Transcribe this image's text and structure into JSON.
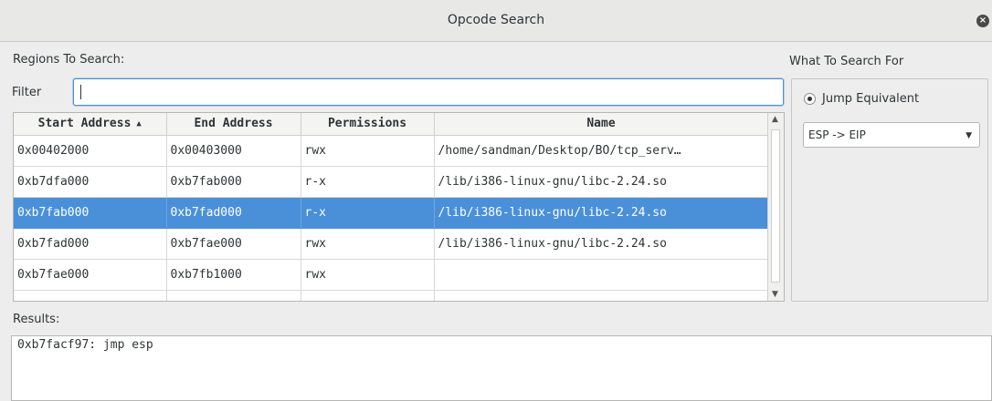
{
  "window": {
    "title": "Opcode Search",
    "close_glyph": "×"
  },
  "regions_label": "Regions To Search:",
  "filter": {
    "label": "Filter",
    "value": "",
    "placeholder": ""
  },
  "table": {
    "columns": [
      "Start Address",
      "End Address",
      "Permissions",
      "Name"
    ],
    "sort_indicator": "▲",
    "rows": [
      {
        "start": "0x00402000",
        "end": "0x00403000",
        "perm": "rwx",
        "name": "/home/sandman/Desktop/BO/tcp_serv…"
      },
      {
        "start": "0xb7dfa000",
        "end": "0xb7fab000",
        "perm": "r-x",
        "name": "/lib/i386-linux-gnu/libc-2.24.so"
      },
      {
        "start": "0xb7fab000",
        "end": "0xb7fad000",
        "perm": "r-x",
        "name": "/lib/i386-linux-gnu/libc-2.24.so"
      },
      {
        "start": "0xb7fad000",
        "end": "0xb7fae000",
        "perm": "rwx",
        "name": "/lib/i386-linux-gnu/libc-2.24.so"
      },
      {
        "start": "0xb7fae000",
        "end": "0xb7fb1000",
        "perm": "rwx",
        "name": ""
      }
    ],
    "selected_row": 2
  },
  "search_for": {
    "label": "What To Search For",
    "option_label": "Jump Equivalent",
    "combo_value": "ESP -> EIP"
  },
  "results": {
    "label": "Results:",
    "text": "0xb7facf97: jmp esp"
  },
  "colors": {
    "selection": "#4a90d9",
    "focus_border": "#4a90d9"
  }
}
